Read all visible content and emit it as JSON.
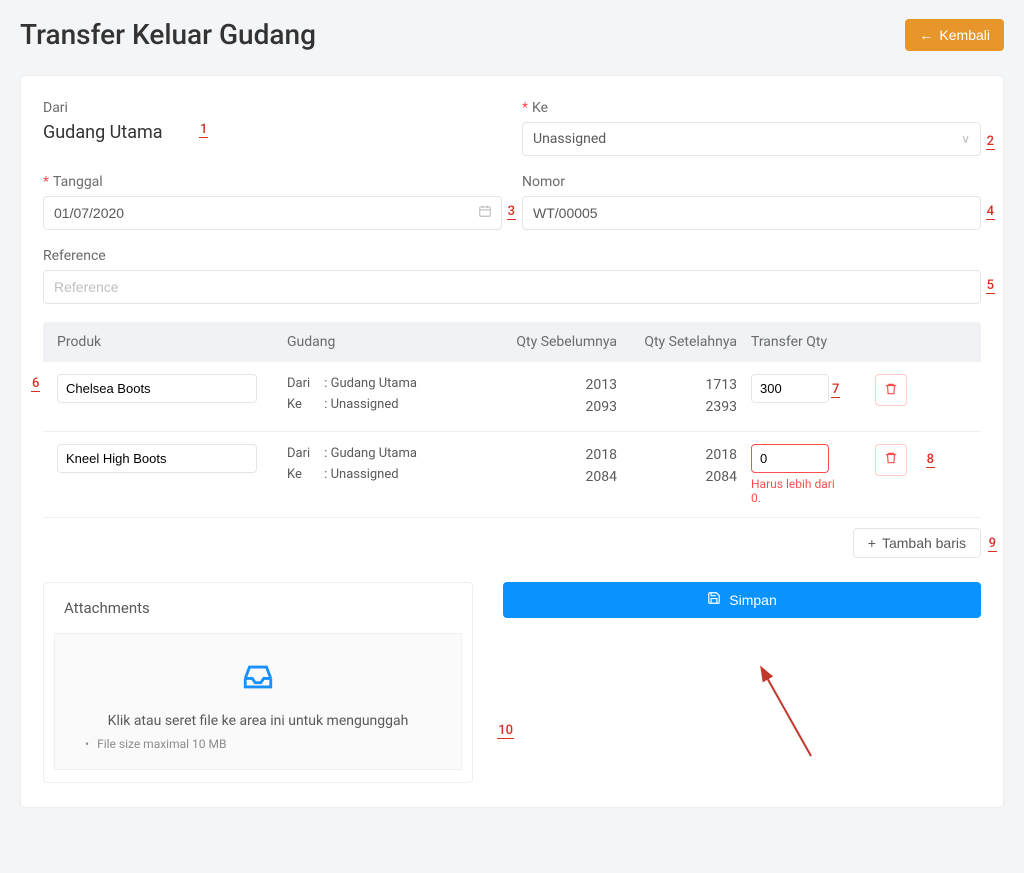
{
  "header": {
    "title": "Transfer Keluar Gudang",
    "back_label": "Kembali"
  },
  "form": {
    "from_label": "Dari",
    "from_value": "Gudang Utama",
    "to_label": "Ke",
    "to_value": "Unassigned",
    "date_label": "Tanggal",
    "date_value": "01/07/2020",
    "number_label": "Nomor",
    "number_value": "WT/00005",
    "reference_label": "Reference",
    "reference_placeholder": "Reference",
    "reference_value": ""
  },
  "table": {
    "headers": {
      "produk": "Produk",
      "gudang": "Gudang",
      "qty_sebelumnya": "Qty Sebelumnya",
      "qty_setelahnya": "Qty Setelahnya",
      "transfer_qty": "Transfer Qty"
    },
    "gudang_from_label": "Dari",
    "gudang_to_label": "Ke",
    "rows": [
      {
        "product": "Chelsea Boots",
        "from_name": "Gudang Utama",
        "to_name": "Unassigned",
        "qty_before_from": "2013",
        "qty_before_to": "2093",
        "qty_after_from": "1713",
        "qty_after_to": "2393",
        "transfer_qty": "300",
        "error": ""
      },
      {
        "product": "Kneel High Boots",
        "from_name": "Gudang Utama",
        "to_name": "Unassigned",
        "qty_before_from": "2018",
        "qty_before_to": "2084",
        "qty_after_from": "2018",
        "qty_after_to": "2084",
        "transfer_qty": "0",
        "error": "Harus lebih dari 0."
      }
    ],
    "add_row_label": "Tambah baris"
  },
  "attachments": {
    "title": "Attachments",
    "drop_text": "Klik atau seret file ke area ini untuk mengunggah",
    "note": "File size maximal 10 MB"
  },
  "actions": {
    "save_label": "Simpan"
  },
  "markers": {
    "m1": "1",
    "m2": "2",
    "m3": "3",
    "m4": "4",
    "m5": "5",
    "m6": "6",
    "m7": "7",
    "m8": "8",
    "m9": "9",
    "m10": "10"
  }
}
